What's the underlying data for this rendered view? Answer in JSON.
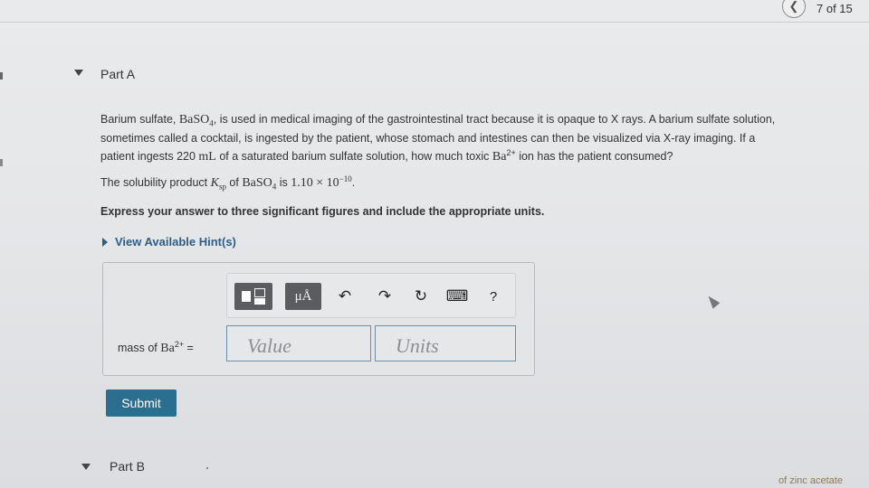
{
  "nav": {
    "prev_icon": "chevron-left-icon",
    "prev_glyph": "❮",
    "page_counter": "7 of 15"
  },
  "part_a": {
    "title": "Part A",
    "problem": {
      "l1a": "Barium sulfate, ",
      "l1_formula": "BaSO",
      "l1_sub": "4",
      "l1b": ", is used in medical imaging of the gastrointestinal tract because it is opaque to X rays. A barium sulfate solution,",
      "l2": "sometimes called a cocktail, is ingested by the patient, whose stomach and intestines can then be visualized via X-ray imaging. If a",
      "l3a": "patient ingests 220 ",
      "l3_unit": "mL",
      "l3b": " of a saturated barium sulfate solution, how much toxic ",
      "l3_ion": "Ba",
      "l3_sup": "2+",
      "l3c": " ion has the patient consumed?"
    },
    "ksp": {
      "t1": "The solubility product ",
      "k": "K",
      "sp": "sp",
      "t2": " of ",
      "formula": "BaSO",
      "sub": "4",
      "t3": " is ",
      "val": "1.10 × 10",
      "exp": "−10",
      "t4": "."
    },
    "instruction": "Express your answer to three significant figures and include the appropriate units.",
    "hint_link": "View Available Hint(s)",
    "toolbar": {
      "templates_icon": "templates-icon",
      "units_label": "μÅ",
      "undo_glyph": "↶",
      "redo_glyph": "↷",
      "reset_glyph": "↻",
      "keyboard_glyph": "⌨",
      "help_glyph": "?"
    },
    "mass_label": {
      "t1": "mass of ",
      "ion": "Ba",
      "sup": "2+",
      "t2": " ="
    },
    "value_placeholder": "Value",
    "units_placeholder": "Units",
    "submit_label": "Submit"
  },
  "part_b": {
    "title": "Part B"
  },
  "bottom_corner_text": "of zinc acetate",
  "colors": {
    "accent": "#2c6e8f",
    "link": "#2a5f8a",
    "input_border": "#6f8fa8"
  }
}
